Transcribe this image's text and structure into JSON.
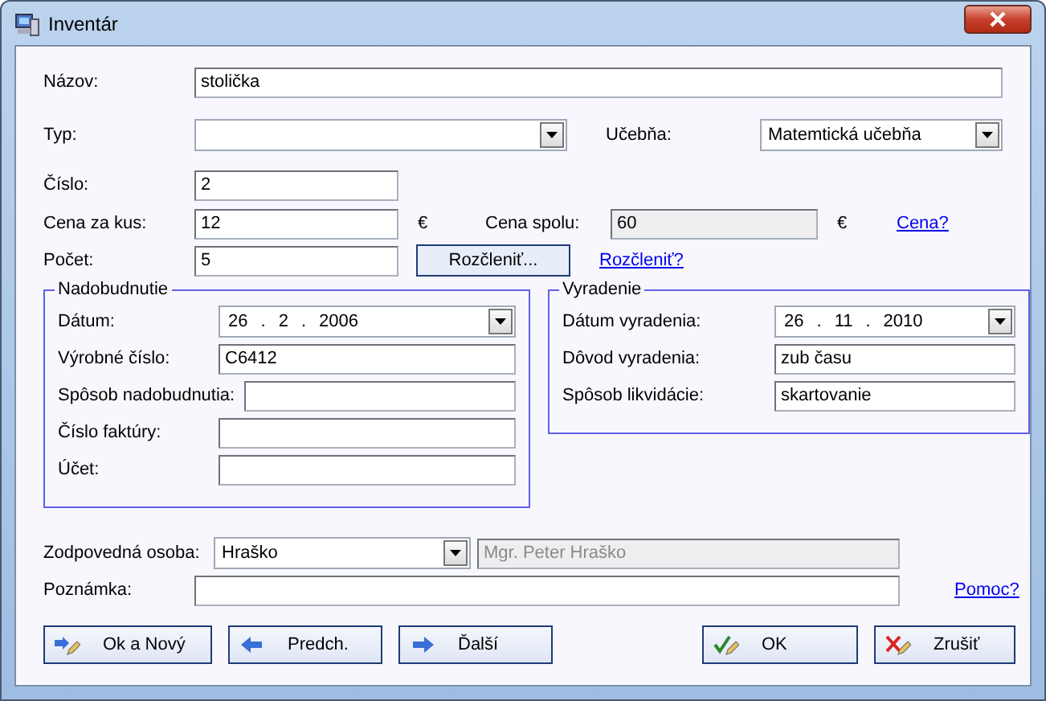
{
  "window": {
    "title": "Inventár"
  },
  "name": {
    "label": "Názov:",
    "value": "stolička"
  },
  "type": {
    "label": "Typ:"
  },
  "classroom": {
    "label": "Učebňa:",
    "value": "Matemtická učebňa"
  },
  "number": {
    "label": "Číslo:",
    "value": "2"
  },
  "unit_price": {
    "label": "Cena za kus:",
    "value": "12",
    "currency": "€"
  },
  "total_price": {
    "label": "Cena spolu:",
    "value": "60",
    "currency": "€",
    "disabled": true
  },
  "price_help": "Cena?",
  "count": {
    "label": "Počet:",
    "value": "5"
  },
  "split_button": "Rozčleniť...",
  "split_help": "Rozčleniť?",
  "acquisition": {
    "title": "Nadobudnutie",
    "date": {
      "label": "Dátum:",
      "day": "26",
      "month": "2",
      "year": "2006",
      "separator": "."
    },
    "fields": [
      {
        "label": "Výrobné číslo:",
        "value": "C6412"
      },
      {
        "label": "Spôsob nadobudnutia:"
      },
      {
        "label": "Číslo faktúry:"
      },
      {
        "label": "Účet:"
      }
    ]
  },
  "disposal": {
    "title": "Vyradenie",
    "date": {
      "label": "Dátum vyradenia:",
      "day": "26",
      "month": "11",
      "year": "2010",
      "separator": "."
    },
    "fields": [
      {
        "label": "Dôvod vyradenia:",
        "value": "zub času"
      },
      {
        "label": "Spôsob likvidácie:",
        "value": "skartovanie"
      }
    ]
  },
  "responsible": {
    "label": "Zodpovedná osoba:",
    "value": "Hraško",
    "full_name": "Mgr. Peter Hraško",
    "full_name_disabled": true
  },
  "note": {
    "label": "Poznámka:"
  },
  "help": "Pomoc?",
  "buttons_left": [
    {
      "kind": "ok_new",
      "label": "Ok a Nový"
    },
    {
      "kind": "prev",
      "label": "Predch."
    },
    {
      "kind": "next",
      "label": "Ďalší"
    }
  ],
  "buttons_right": [
    {
      "kind": "ok",
      "label": "OK"
    },
    {
      "kind": "cancel",
      "label": "Zrušiť"
    }
  ]
}
